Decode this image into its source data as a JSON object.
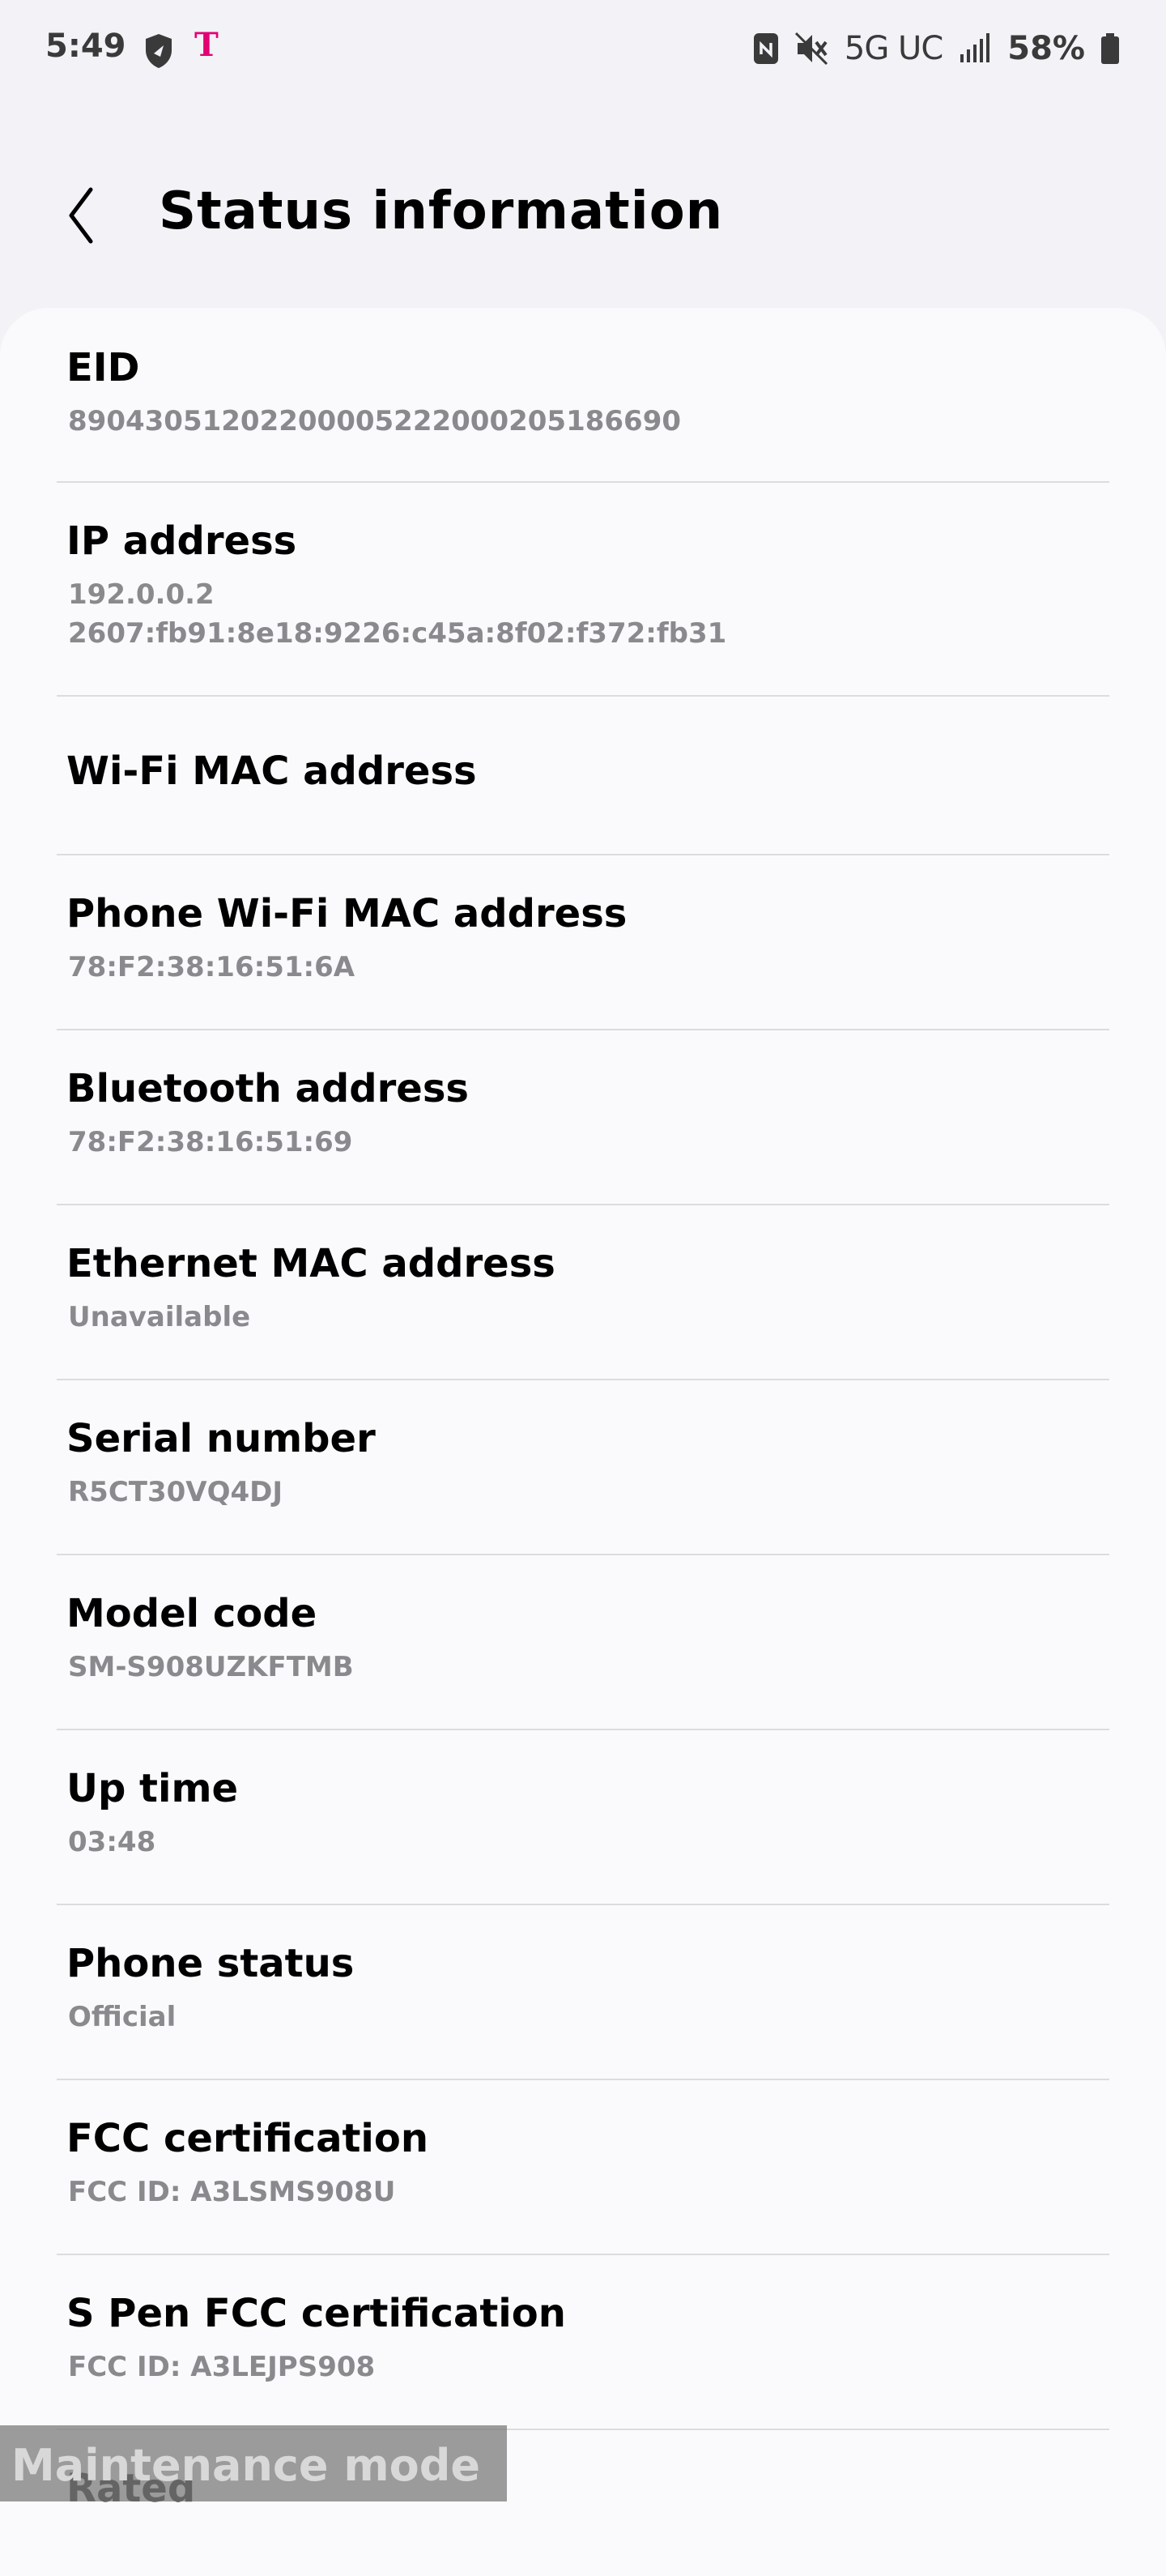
{
  "status_bar": {
    "time": "5:49",
    "carrier_icon": "T",
    "network": "5G UC",
    "battery": "58%",
    "icons": [
      "shield-icon",
      "nfc-icon",
      "mute-icon",
      "signal-icon",
      "battery-icon"
    ]
  },
  "header": {
    "title": "Status information",
    "back_icon": "chevron-left-icon"
  },
  "items": [
    {
      "title": "EID",
      "values": [
        "89043051202200005222000205186690"
      ]
    },
    {
      "title": "IP address",
      "values": [
        "192.0.0.2",
        "2607:fb91:8e18:9226:c45a:8f02:f372:fb31"
      ]
    },
    {
      "title": "Wi-Fi MAC address",
      "values": []
    },
    {
      "title": "Phone Wi-Fi MAC address",
      "values": [
        "78:F2:38:16:51:6A"
      ]
    },
    {
      "title": "Bluetooth address",
      "values": [
        "78:F2:38:16:51:69"
      ]
    },
    {
      "title": "Ethernet MAC address",
      "values": [
        "Unavailable"
      ]
    },
    {
      "title": "Serial number",
      "values": [
        "R5CT30VQ4DJ"
      ]
    },
    {
      "title": "Model code",
      "values": [
        "SM-S908UZKFTMB"
      ]
    },
    {
      "title": "Up time",
      "values": [
        "03:48"
      ]
    },
    {
      "title": "Phone status",
      "values": [
        "Official"
      ]
    },
    {
      "title": "FCC certification",
      "values": [
        "FCC ID: A3LSMS908U"
      ]
    },
    {
      "title": "S Pen FCC certification",
      "values": [
        "FCC ID: A3LEJPS908"
      ]
    },
    {
      "title": "Rated",
      "values": []
    }
  ],
  "overlay": {
    "maintenance": "Maintenance mode"
  },
  "colors": {
    "background": "#f2f2f7",
    "card": "#fafafc",
    "secondary_text": "#8a8a8e",
    "carrier": "#e20074"
  }
}
